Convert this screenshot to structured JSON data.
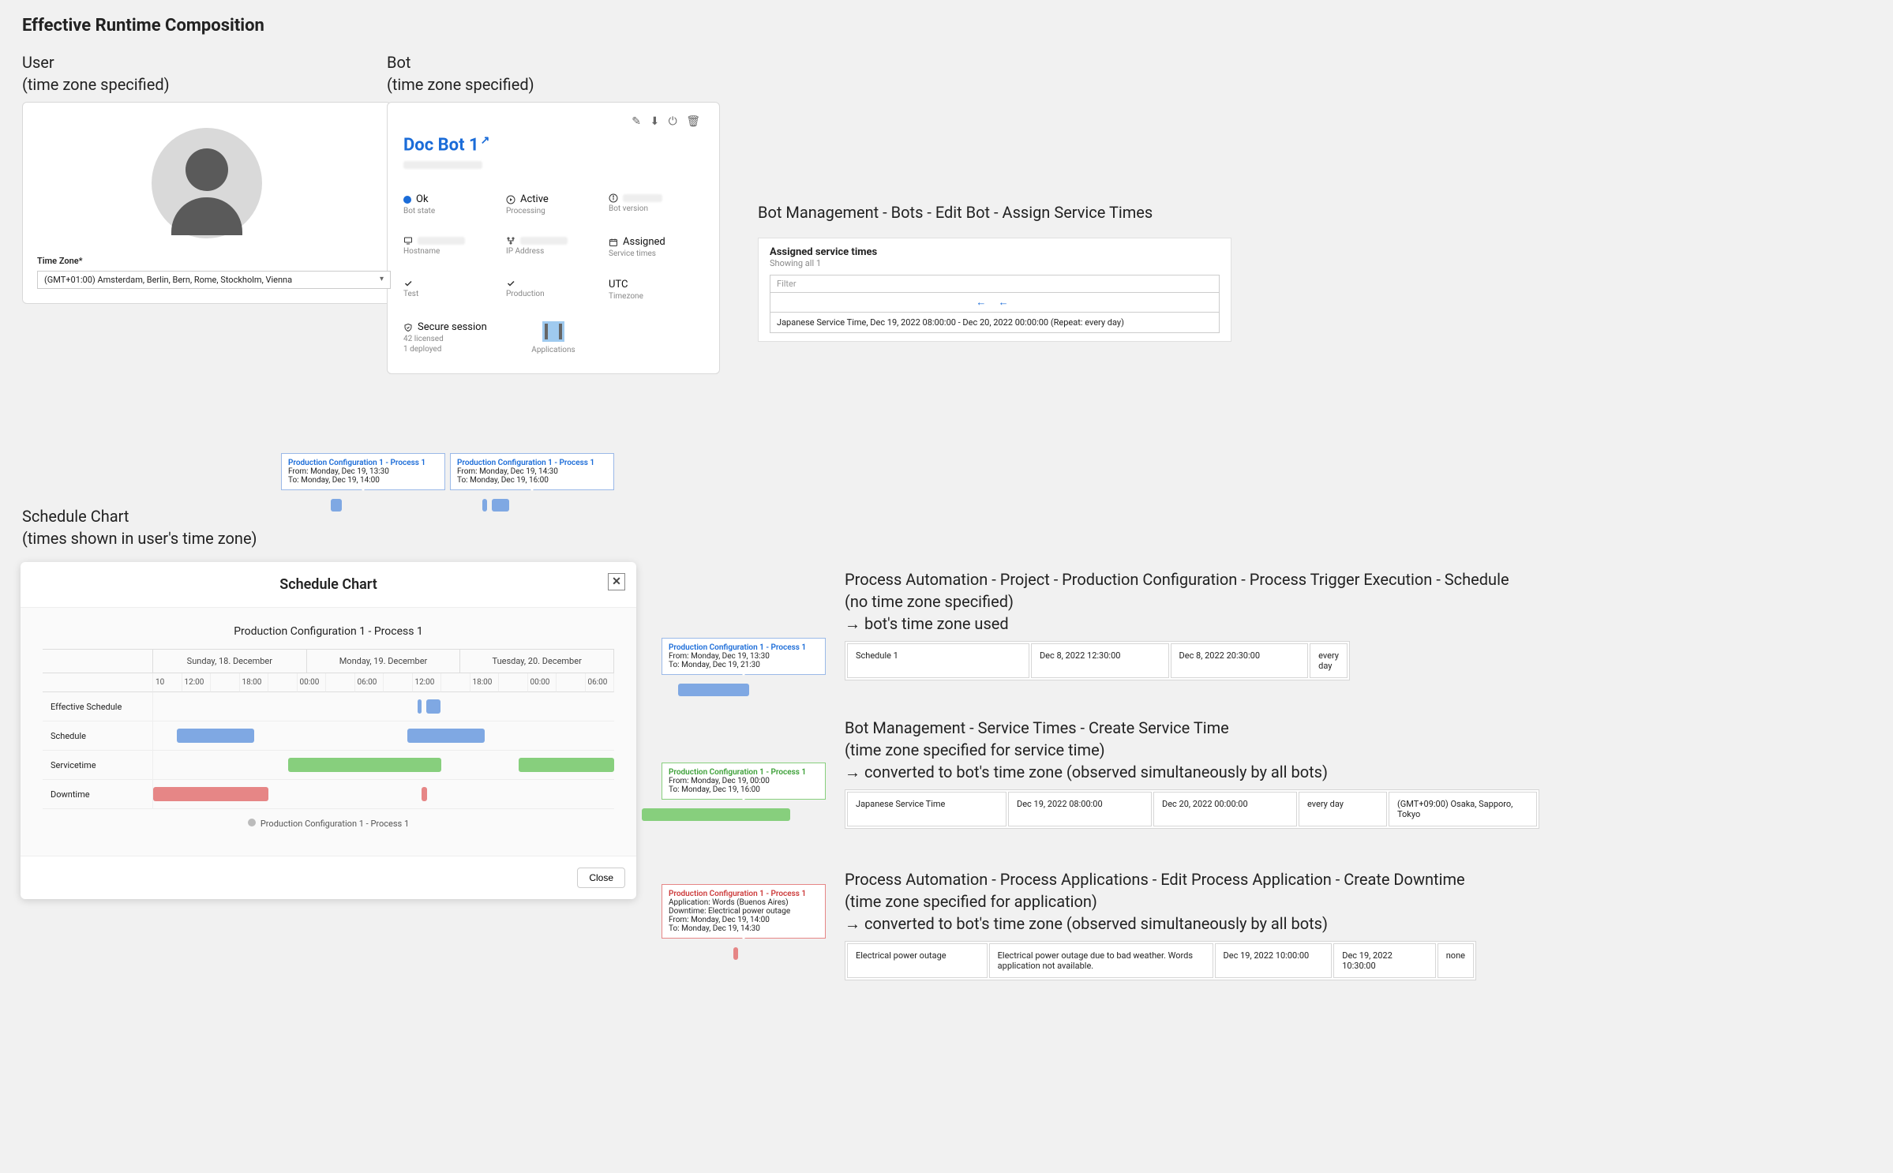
{
  "title": "Effective Runtime Composition",
  "user_section": {
    "heading_l1": "User",
    "heading_l2": "(time zone specified)",
    "tz_label": "Time Zone*",
    "tz_value": "(GMT+01:00) Amsterdam, Berlin, Bern, Rome, Stockholm, Vienna"
  },
  "bot_section": {
    "heading_l1": "Bot",
    "heading_l2": "(time zone specified)",
    "bot_name": "Doc Bot 1",
    "cells": {
      "state": {
        "v": "Ok",
        "k": "Bot state"
      },
      "active": {
        "v": "Active",
        "k": "Processing"
      },
      "version": {
        "v": "",
        "k": "Bot version"
      },
      "hostname": {
        "v": "",
        "k": "Hostname"
      },
      "ip": {
        "v": "",
        "k": "IP Address"
      },
      "assigned": {
        "v": "Assigned",
        "k": "Service times"
      },
      "test": {
        "v": "",
        "k": "Test"
      },
      "prod": {
        "v": "",
        "k": "Production"
      },
      "tz": {
        "v": "UTC",
        "k": "Timezone"
      },
      "secure": {
        "v": "Secure session",
        "k1": "42 licensed",
        "k2": "1 deployed"
      },
      "apps": {
        "k": "Applications"
      }
    }
  },
  "assign_section": {
    "heading": "Bot Management - Bots - Edit Bot - Assign Service Times",
    "panel_title": "Assigned service times",
    "showing": "Showing all 1",
    "filter_placeholder": "Filter",
    "item": "Japanese Service Time, Dec 19, 2022 08:00:00 - Dec 20, 2022 00:00:00 (Repeat: every day)"
  },
  "tips": {
    "a": {
      "title": "Production Configuration 1 - Process 1",
      "from": "From: Monday, Dec 19, 13:30",
      "to": "To: Monday, Dec 19, 14:00"
    },
    "b": {
      "title": "Production Configuration 1 - Process 1",
      "from": "From: Monday, Dec 19, 14:30",
      "to": "To: Monday, Dec 19, 16:00"
    },
    "c": {
      "title": "Production Configuration 1 - Process 1",
      "from": "From: Monday, Dec 19, 13:30",
      "to": "To: Monday, Dec 19, 21:30"
    },
    "d": {
      "title": "Production Configuration 1 - Process 1",
      "from": "From: Monday, Dec 19, 00:00",
      "to": "To: Monday, Dec 19, 16:00"
    },
    "e": {
      "title": "Production Configuration 1 - Process 1",
      "app": "Application: Words (Buenos Aires)",
      "dt": "Downtime: Electrical power outage",
      "from": "From: Monday, Dec 19, 14:00",
      "to": "To: Monday, Dec 19, 14:30"
    }
  },
  "sched_section": {
    "heading_l1": "Schedule Chart",
    "heading_l2": "(times shown in user's time zone)"
  },
  "chart": {
    "title": "Schedule Chart",
    "subtitle": "Production Configuration 1 - Process 1",
    "close": "Close",
    "days": [
      "Sunday, 18. December",
      "Monday, 19. December",
      "Tuesday, 20. December"
    ],
    "grid_start_10": "10",
    "times": [
      "12:00",
      "18:00",
      "00:00",
      "06:00",
      "12:00",
      "18:00",
      "00:00",
      "06:00"
    ],
    "rows": {
      "eff": "Effective Schedule",
      "sch": "Schedule",
      "svc": "Servicetime",
      "dwn": "Downtime"
    },
    "legend": "Production Configuration 1 - Process 1"
  },
  "chart_data": {
    "type": "bar",
    "x_axis": "hours from Sun 18 Dec 10:00 (user tz GMT+1)",
    "x_range_hours": 48,
    "series": [
      {
        "name": "Effective Schedule",
        "color": "#7fa8e3",
        "intervals": [
          [
            27.5,
            28.0
          ],
          [
            28.5,
            30.0
          ]
        ]
      },
      {
        "name": "Schedule",
        "color": "#7fa8e3",
        "intervals": [
          [
            2.5,
            10.5
          ],
          [
            26.5,
            34.5
          ]
        ]
      },
      {
        "name": "Servicetime",
        "color": "#87cf7d",
        "intervals": [
          [
            14.0,
            30.0
          ],
          [
            38.0,
            48.0
          ]
        ]
      },
      {
        "name": "Downtime",
        "color": "#e68686",
        "intervals": [
          [
            0,
            12.0
          ],
          [
            28.0,
            28.5
          ]
        ]
      }
    ]
  },
  "trigger": {
    "heading_l1": "Process Automation -  Project - Production Configuration - Process Trigger Execution - Schedule",
    "heading_l2": "(no time zone specified)",
    "heading_l3": "→ bot's time zone used",
    "row": [
      "Schedule 1",
      "Dec 8, 2022 12:30:00",
      "Dec 8, 2022 20:30:00",
      "every day"
    ]
  },
  "svc": {
    "heading_l1": "Bot Management - Service Times - Create Service Time",
    "heading_l2": "(time zone specified for service time)",
    "heading_l3": "→ converted to bot's time zone (observed simultaneously by all bots)",
    "row": [
      "Japanese Service Time",
      "Dec 19, 2022 08:00:00",
      "Dec 20, 2022 00:00:00",
      "every day",
      "(GMT+09:00) Osaka, Sapporo, Tokyo"
    ]
  },
  "dwn": {
    "heading_l1": "Process Automation - Process Applications - Edit Process Application - Create Downtime",
    "heading_l2": "(time zone specified for application)",
    "heading_l3": "→ converted to bot's time zone (observed simultaneously by all bots)",
    "row": [
      "Electrical power outage",
      "Electrical power outage due to bad weather. Words application not available.",
      "Dec 19, 2022 10:00:00",
      "Dec 19, 2022 10:30:00",
      "none"
    ]
  }
}
